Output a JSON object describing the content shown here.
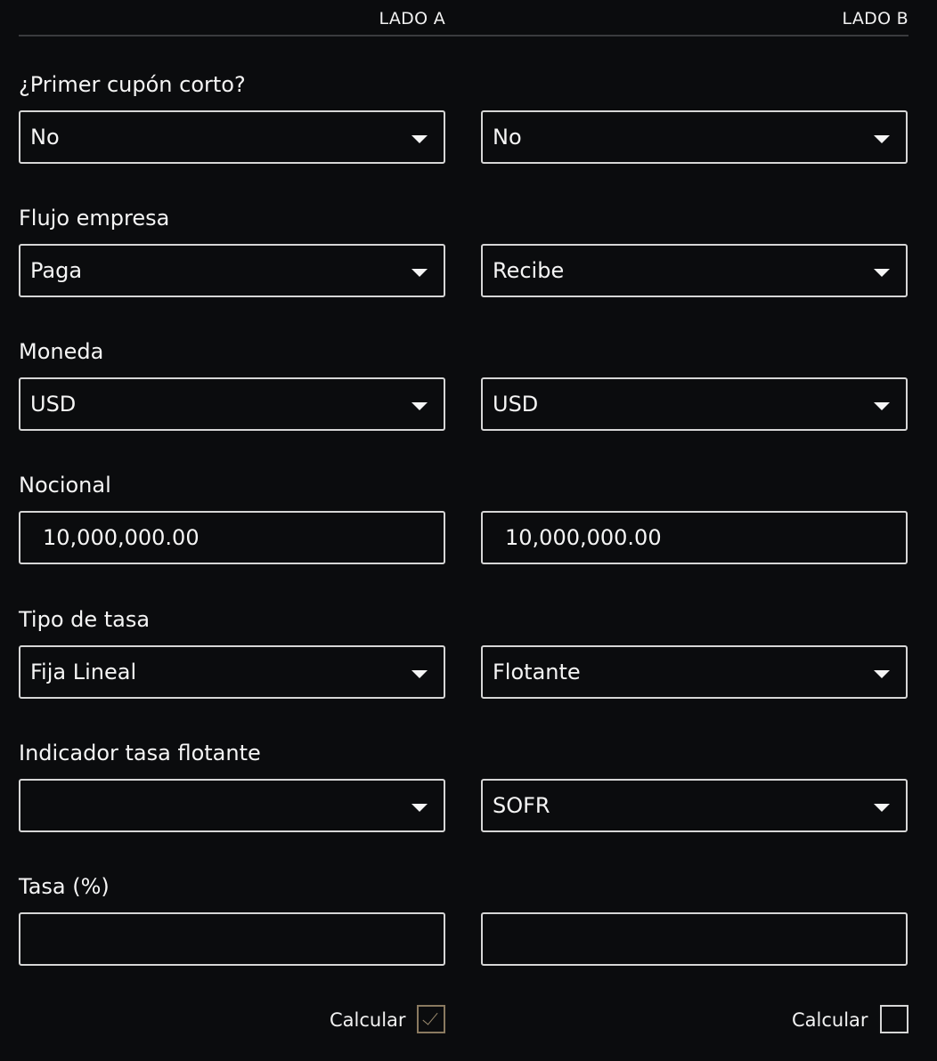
{
  "header": {
    "side_a": "LADO A",
    "side_b": "LADO B"
  },
  "rows": [
    {
      "label": "¿Primer cupón corto?",
      "side_a": "No",
      "side_b": "No"
    },
    {
      "label": "Flujo empresa",
      "side_a": "Paga",
      "side_b": "Recibe"
    },
    {
      "label": "Moneda",
      "side_a": "USD",
      "side_b": "USD"
    },
    {
      "label": "Nocional",
      "side_a": "10,000,000.00",
      "side_b": "10,000,000.00"
    },
    {
      "label": "Tipo de tasa",
      "side_a": "Fija Lineal",
      "side_b": "Flotante"
    },
    {
      "label": "Indicador tasa flotante",
      "side_a": "",
      "side_b": "SOFR"
    },
    {
      "label": "Tasa (%)",
      "side_a": "",
      "side_b": ""
    }
  ],
  "calcular": {
    "side_a": {
      "label": "Calcular",
      "checked": true
    },
    "side_b": {
      "label": "Calcular",
      "checked": false
    }
  },
  "icons": {
    "dropdown": "caret-down-icon",
    "check": "check-icon"
  },
  "colors": {
    "background": "#0b0c0e",
    "border": "#d6d6d6",
    "text": "#f5f5f5",
    "checked_accent": "#8a7a60"
  }
}
